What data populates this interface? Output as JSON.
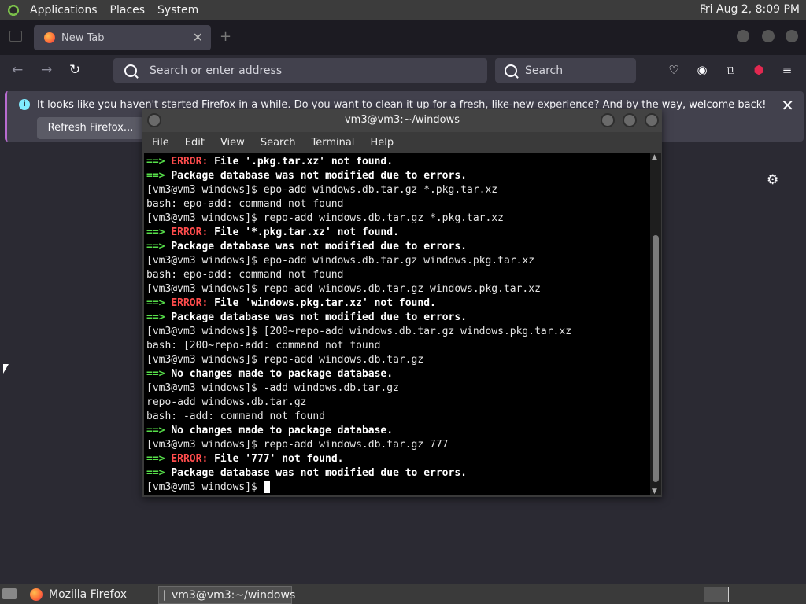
{
  "top_panel": {
    "menus": [
      "Applications",
      "Places",
      "System"
    ],
    "clock": "Fri Aug  2,  8:09 PM"
  },
  "firefox": {
    "tab_title": "New Tab",
    "url_placeholder": "Search or enter address",
    "search_placeholder": "Search",
    "notification": {
      "message": "It looks like you haven't started Firefox in a while. Do you want to clean it up for a fresh, like-new experience? And by the way, welcome back!",
      "button": "Refresh Firefox..."
    }
  },
  "terminal": {
    "title": "vm3@vm3:~/windows",
    "menus": [
      "File",
      "Edit",
      "View",
      "Search",
      "Terminal",
      "Help"
    ],
    "lines": [
      {
        "type": "error",
        "arrow": "==> ",
        "tag": "ERROR:",
        "text": " File '.pkg.tar.xz' not found."
      },
      {
        "type": "info",
        "arrow": "==> ",
        "text": "Package database was not modified due to errors."
      },
      {
        "type": "plain",
        "text": "[vm3@vm3 windows]$ epo-add windows.db.tar.gz *.pkg.tar.xz"
      },
      {
        "type": "plain",
        "text": "bash: epo-add: command not found"
      },
      {
        "type": "plain",
        "text": "[vm3@vm3 windows]$ repo-add windows.db.tar.gz *.pkg.tar.xz"
      },
      {
        "type": "error",
        "arrow": "==> ",
        "tag": "ERROR:",
        "text": " File '*.pkg.tar.xz' not found."
      },
      {
        "type": "info",
        "arrow": "==> ",
        "text": "Package database was not modified due to errors."
      },
      {
        "type": "plain",
        "text": "[vm3@vm3 windows]$ epo-add windows.db.tar.gz windows.pkg.tar.xz"
      },
      {
        "type": "plain",
        "text": "bash: epo-add: command not found"
      },
      {
        "type": "plain",
        "text": "[vm3@vm3 windows]$ repo-add windows.db.tar.gz windows.pkg.tar.xz"
      },
      {
        "type": "error",
        "arrow": "==> ",
        "tag": "ERROR:",
        "text": " File 'windows.pkg.tar.xz' not found."
      },
      {
        "type": "info",
        "arrow": "==> ",
        "text": "Package database was not modified due to errors."
      },
      {
        "type": "plain",
        "text": "[vm3@vm3 windows]$ [200~repo-add windows.db.tar.gz windows.pkg.tar.xz"
      },
      {
        "type": "plain",
        "text": "bash: [200~repo-add: command not found"
      },
      {
        "type": "plain",
        "text": "[vm3@vm3 windows]$ repo-add windows.db.tar.gz"
      },
      {
        "type": "info",
        "arrow": "==> ",
        "text": "No changes made to package database."
      },
      {
        "type": "plain",
        "text": "[vm3@vm3 windows]$ -add windows.db.tar.gz"
      },
      {
        "type": "plain",
        "text": "repo-add windows.db.tar.gz"
      },
      {
        "type": "plain",
        "text": "bash: -add: command not found"
      },
      {
        "type": "info",
        "arrow": "==> ",
        "text": "No changes made to package database."
      },
      {
        "type": "plain",
        "text": "[vm3@vm3 windows]$ repo-add windows.db.tar.gz 777"
      },
      {
        "type": "error",
        "arrow": "==> ",
        "tag": "ERROR:",
        "text": " File '777' not found."
      },
      {
        "type": "info",
        "arrow": "==> ",
        "text": "Package database was not modified due to errors."
      },
      {
        "type": "prompt",
        "text": "[vm3@vm3 windows]$ "
      }
    ]
  },
  "taskbar": {
    "items": [
      "Mozilla Firefox",
      "vm3@vm3:~/windows"
    ]
  }
}
